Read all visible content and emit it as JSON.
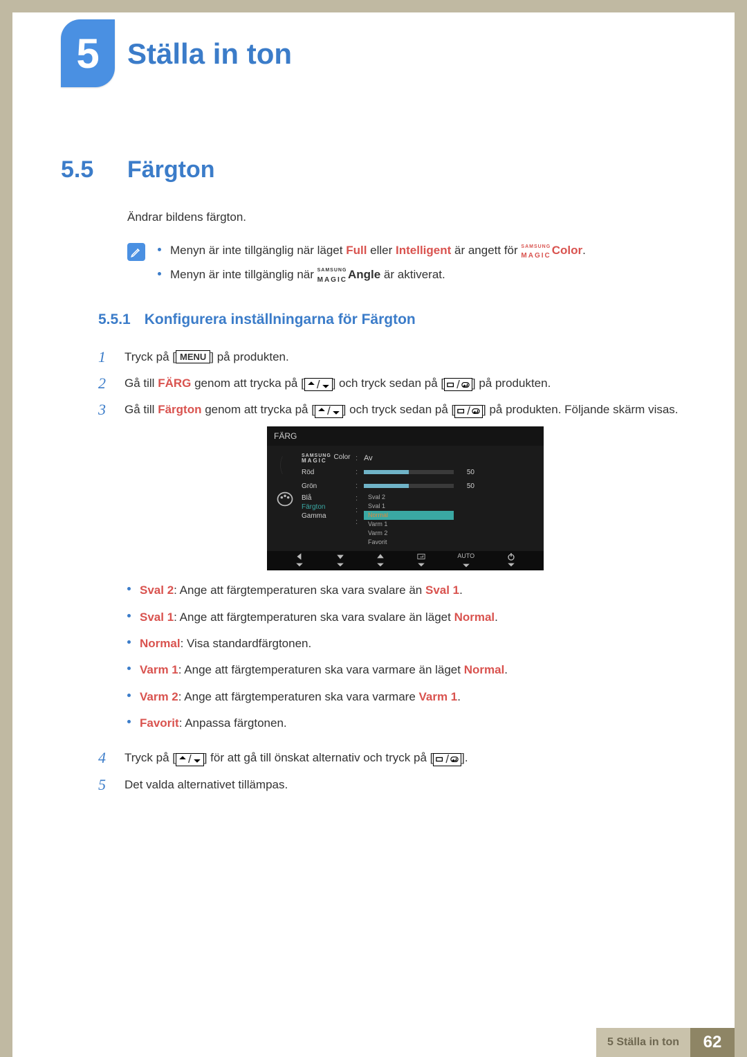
{
  "chapter": {
    "number": "5",
    "title": "Ställa in ton"
  },
  "section": {
    "number": "5.5",
    "title": "Färgton"
  },
  "intro": "Ändrar bildens färgton.",
  "notes": {
    "n1_pre": "Menyn är inte tillgänglig när läget ",
    "n1_full": "Full",
    "n1_or": " eller ",
    "n1_intel": "Intelligent",
    "n1_mid": " är angett för ",
    "n1_color": "Color",
    "n1_post": ".",
    "n2_pre": "Menyn är inte tillgänglig när ",
    "n2_angle": "Angle",
    "n2_post": " är aktiverat.",
    "magic_sam": "SAMSUNG",
    "magic_magic": "MAGIC"
  },
  "subsection": {
    "number": "5.5.1",
    "title": "Konfigurera inställningarna för Färgton"
  },
  "steps": {
    "s1_pre": "Tryck på [",
    "s1_menu": "MENU",
    "s1_post": "] på produkten.",
    "s2_pre": "Gå till ",
    "s2_farg": "FÄRG",
    "s2_mid1": " genom att trycka på [",
    "s2_mid2": "] och tryck sedan på [",
    "s2_post": "] på produkten.",
    "s3_pre": "Gå till ",
    "s3_fargton": "Färgton",
    "s3_mid1": " genom att trycka på [",
    "s3_mid2": "] och tryck sedan på [",
    "s3_post": "] på produkten. Följande skärm visas.",
    "s4_pre": "Tryck på [",
    "s4_mid": "] för att gå till önskat alternativ och tryck på [",
    "s4_post": "].",
    "s5": "Det valda alternativet tillämpas."
  },
  "options": {
    "sval2_l": "Sval 2",
    "sval2_t": ": Ange att färgtemperaturen ska vara svalare än ",
    "sval2_r": "Sval 1",
    "sval2_p": ".",
    "sval1_l": "Sval 1",
    "sval1_t": ": Ange att färgtemperaturen ska vara svalare än läget ",
    "sval1_r": "Normal",
    "sval1_p": ".",
    "normal_l": "Normal",
    "normal_t": ": Visa standardfärgtonen.",
    "varm1_l": "Varm 1",
    "varm1_t": ": Ange att färgtemperaturen ska vara varmare än läget ",
    "varm1_r": "Normal",
    "varm1_p": ".",
    "varm2_l": "Varm 2",
    "varm2_t": ": Ange att färgtemperaturen ska vara varmare ",
    "varm2_r": "Varm 1",
    "varm2_p": ".",
    "fav_l": "Favorit",
    "fav_t": ": Anpassa färgtonen."
  },
  "osd": {
    "title": "FÄRG",
    "rows": {
      "magic_color": " Color",
      "magic_color_val": "Av",
      "red": "Röd",
      "red_val": "50",
      "green": "Grön",
      "green_val": "50",
      "blue": "Blå",
      "fargton": "Färgton",
      "gamma": "Gamma"
    },
    "dropdown": [
      "Sval 2",
      "Sval 1",
      "Normal",
      "Varm 1",
      "Varm 2",
      "Favorit"
    ],
    "auto": "AUTO"
  },
  "footer": {
    "label": "5 Ställa in ton",
    "page": "62"
  }
}
